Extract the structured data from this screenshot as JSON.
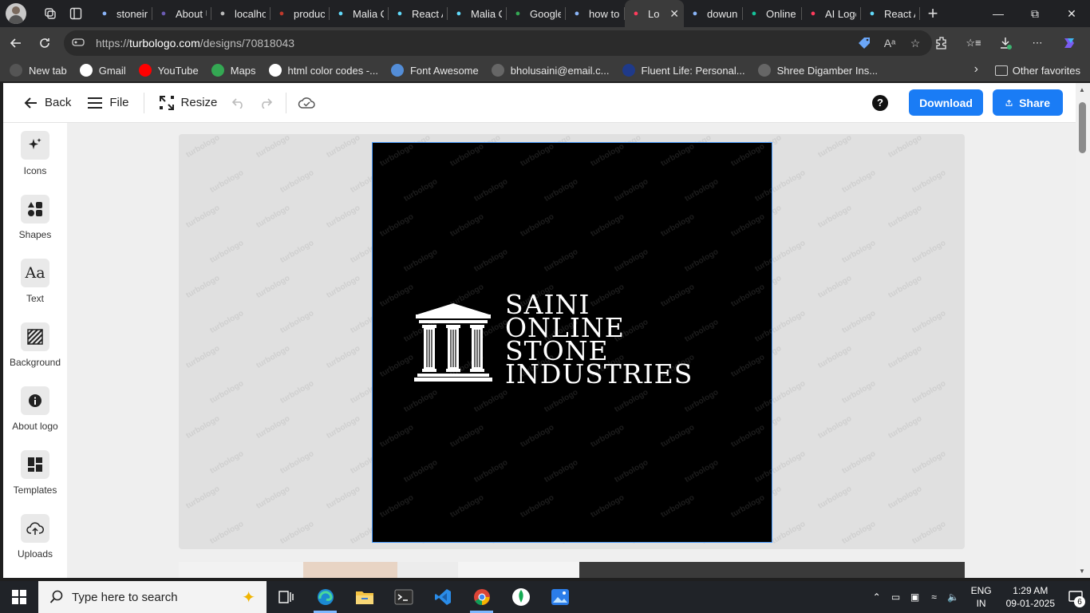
{
  "browser": {
    "tabs": [
      {
        "label": "stoneir",
        "icon": "search-icon",
        "color": "#8ab4f8"
      },
      {
        "label": "About U",
        "icon": "site-icon",
        "color": "#6b5bb3"
      },
      {
        "label": "localho",
        "icon": "page-icon",
        "color": "#bbbbbb"
      },
      {
        "label": "produc",
        "icon": "m-logo-icon",
        "color": "#c0392b"
      },
      {
        "label": "Malia C",
        "icon": "react-icon",
        "color": "#61dafb"
      },
      {
        "label": "React A",
        "icon": "react-icon",
        "color": "#61dafb"
      },
      {
        "label": "Malia C",
        "icon": "react-icon",
        "color": "#61dafb"
      },
      {
        "label": "Google",
        "icon": "maps-icon",
        "color": "#34a853"
      },
      {
        "label": "how to",
        "icon": "search-icon",
        "color": "#8ab4f8"
      },
      {
        "label": "Lo",
        "icon": "turbologo-icon",
        "color": "#ff3b5c",
        "active": true
      },
      {
        "label": "dowunl",
        "icon": "search-icon",
        "color": "#8ab4f8"
      },
      {
        "label": "Online",
        "icon": "grammarly-icon",
        "color": "#15c39a"
      },
      {
        "label": "AI Logo",
        "icon": "turbologo-icon",
        "color": "#ff3b5c"
      },
      {
        "label": "React A",
        "icon": "react-icon",
        "color": "#61dafb"
      }
    ],
    "url_prefix": "https://",
    "url_host": "turbologo.com",
    "url_path": "/designs/70818043",
    "bookmarks": [
      {
        "label": "New tab",
        "icon": "newtab-icon",
        "color": "#555555"
      },
      {
        "label": "Gmail",
        "icon": "google-icon",
        "color": "#ffffff"
      },
      {
        "label": "YouTube",
        "icon": "youtube-icon",
        "color": "#ff0000"
      },
      {
        "label": "Maps",
        "icon": "maps-icon",
        "color": "#34a853"
      },
      {
        "label": "html color codes -...",
        "icon": "google-icon",
        "color": "#ffffff"
      },
      {
        "label": "Font Awesome",
        "icon": "flag-icon",
        "color": "#538dd7"
      },
      {
        "label": "bholusaini@email.c...",
        "icon": "globe-icon",
        "color": "#666666"
      },
      {
        "label": "Fluent Life: Personal...",
        "icon": "fluent-icon",
        "color": "#1f3a8a"
      },
      {
        "label": "Shree Digamber Ins...",
        "icon": "globe-icon",
        "color": "#666666"
      }
    ],
    "other_favorites": "Other favorites"
  },
  "editor": {
    "back_label": "Back",
    "file_label": "File",
    "resize_label": "Resize",
    "download_label": "Download",
    "share_label": "Share",
    "sidebar": [
      {
        "label": "Icons",
        "icon": "sparkles-icon"
      },
      {
        "label": "Shapes",
        "icon": "shapes-icon"
      },
      {
        "label": "Text",
        "icon": "text-aa-icon"
      },
      {
        "label": "Background",
        "icon": "stripes-icon"
      },
      {
        "label": "About logo",
        "icon": "info-icon"
      },
      {
        "label": "Templates",
        "icon": "grid-icon"
      },
      {
        "label": "Uploads",
        "icon": "cloud-upload-icon"
      }
    ],
    "watermark_text": "turbologo",
    "logo": {
      "lines": [
        "SAINI",
        "ONLINE",
        "STONE",
        "INDUSTRIES"
      ],
      "icon": "greek-temple-icon",
      "background": "#000000",
      "foreground": "#ffffff"
    }
  },
  "taskbar": {
    "search_placeholder": "Type here to search",
    "apps": [
      "task-view-icon",
      "edge-icon",
      "file-explorer-icon",
      "terminal-icon",
      "vscode-icon",
      "chrome-icon",
      "mongodb-icon",
      "photos-icon"
    ],
    "lang_top": "ENG",
    "lang_bottom": "IN",
    "time": "1:29 AM",
    "date": "09-01-2025",
    "notification_count": "6"
  }
}
